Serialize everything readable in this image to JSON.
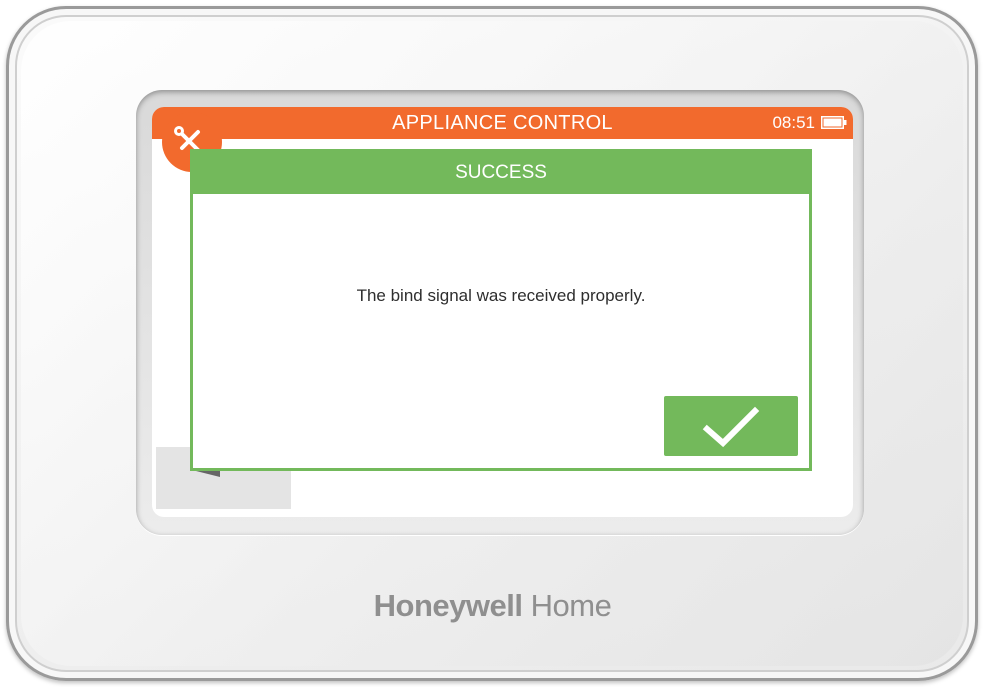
{
  "header": {
    "title": "APPLIANCE CONTROL",
    "time": "08:51",
    "app_icon": "wrench-screwdriver-icon",
    "battery_icon": "battery-icon",
    "color": "#f26a2d"
  },
  "dialog": {
    "title": "SUCCESS",
    "message": "The bind signal was received properly.",
    "confirm_icon": "checkmark-icon",
    "color": "#73b95b"
  },
  "navigation": {
    "back_icon": "back-arrow-icon"
  },
  "branding": {
    "brand_bold": "Honeywell",
    "brand_light": " Home"
  }
}
